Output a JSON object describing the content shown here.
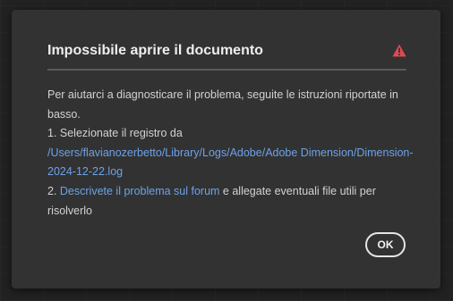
{
  "dialog": {
    "title": "Impossibile aprire il documento",
    "alert_icon": "alert-triangle-icon",
    "alert_color": "#e34850",
    "intro": "Per aiutarci a diagnosticare il problema, seguite le istruzioni riportate in basso.",
    "step1_text": "1. Selezionate il registro da",
    "step1_path": "/Users/flavianozerbetto/Library/Logs/Adobe/Adobe Dimension/Dimension-2024-12-22.log",
    "step2_prefix": "2. ",
    "step2_link": "Descrivete il problema sul forum",
    "step2_suffix": " e allegate eventuali file utili per risolverlo",
    "ok_label": "OK"
  },
  "colors": {
    "dialog_bg": "#323232",
    "link": "#6ca2e8",
    "text": "#d2d2d2"
  }
}
